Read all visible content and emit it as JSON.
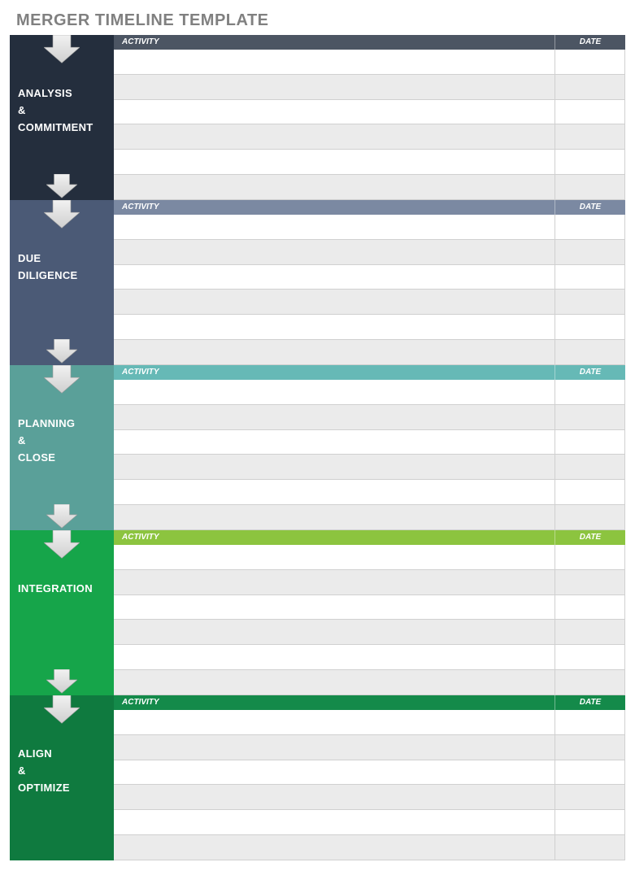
{
  "title": "MERGER TIMELINE TEMPLATE",
  "columns": {
    "activity": "ACTIVITY",
    "date": "DATE"
  },
  "phases": [
    {
      "label": "ANALYSIS\n&\nCOMMITMENT",
      "bg": "#242e3d",
      "headerBg": "#4c5563"
    },
    {
      "label": "DUE\nDILIGENCE",
      "bg": "#4b5a76",
      "headerBg": "#7b89a2"
    },
    {
      "label": "PLANNING\n&\nCLOSE",
      "bg": "#5aa099",
      "headerBg": "#66b9b6"
    },
    {
      "label": "INTEGRATION",
      "bg": "#16a54a",
      "headerBg": "#8cc43f"
    },
    {
      "label": "ALIGN\n&\nOPTIMIZE",
      "bg": "#0f7a3f",
      "headerBg": "#148a4a"
    }
  ],
  "rowsPerPhase": 6
}
